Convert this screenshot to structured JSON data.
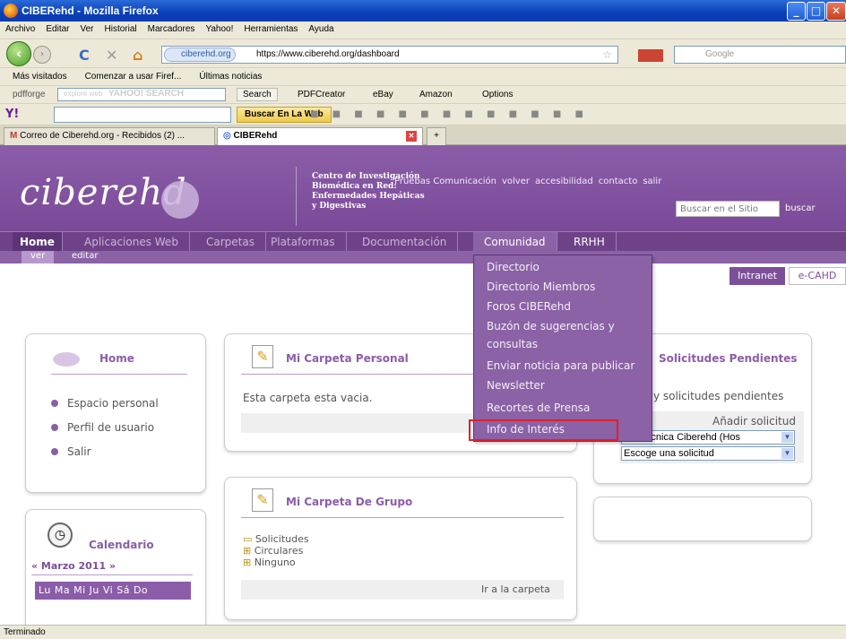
{
  "window": {
    "title": "CIBERehd - Mozilla Firefox"
  },
  "menubar": [
    "Archivo",
    "Editar",
    "Ver",
    "Historial",
    "Marcadores",
    "Yahoo!",
    "Herramientas",
    "Ayuda"
  ],
  "navbar": {
    "site_badge": "ciberehd.org",
    "url": "https://www.ciberehd.org/dashboard",
    "search_placeholder": "Google"
  },
  "bookmarks": [
    "Más visitados",
    "Comenzar a usar Firef...",
    "Últimas noticias"
  ],
  "pdfbar": {
    "brand": "pdfforge",
    "search_placeholder": "explore web",
    "yahoo": "YAHOO! SEARCH",
    "search_btn": "Search",
    "items": [
      "PDFCreator",
      "eBay",
      "Amazon",
      "Options"
    ]
  },
  "yahoobar": {
    "button": "Buscar En La Web"
  },
  "tabs": [
    {
      "label": "Correo de Ciberehd.org - Recibidos (2) ...",
      "active": false
    },
    {
      "label": "CIBERehd",
      "active": true
    }
  ],
  "header": {
    "logo": "ciberehd",
    "centro": [
      "Centro de Investigación",
      "Biomédica en Red:",
      "Enfermedades Hepáticas",
      "y Digestivas"
    ],
    "toplinks": [
      "Pruebas Comunicación",
      "volver",
      "accesibilidad",
      "contacto",
      "salir"
    ],
    "search_placeholder": "Buscar en el Sitio",
    "search_btn": "buscar"
  },
  "mainnav": [
    "Home",
    "Aplicaciones Web",
    "Carpetas",
    "Plataformas",
    "Documentación",
    "Comunidad",
    "RRHH"
  ],
  "subnav": [
    "ver",
    "editar"
  ],
  "dropdown": [
    "Directorio",
    "Directorio Miembros",
    "Foros CIBERehd",
    "Buzón de sugerencias y",
    "consultas",
    "Enviar noticia para publicar",
    "Newsletter",
    "Recortes de Prensa",
    "Info de Interés"
  ],
  "buttons": {
    "intranet": "Intranet",
    "ecahd": "e-CAHD"
  },
  "home_panel": {
    "title": "Home",
    "items": [
      "Espacio personal",
      "Perfil de usuario",
      "Salir"
    ]
  },
  "carpeta_personal": {
    "title": "Mi Carpeta Personal",
    "text": "Esta carpeta esta vacia."
  },
  "carpeta_grupo": {
    "title": "Mi Carpeta De Grupo",
    "items": [
      "Solicitudes",
      "Circulares",
      "Ninguno"
    ],
    "link": "Ir a la carpeta"
  },
  "solicitudes": {
    "title": "Solicitudes Pendientes",
    "text": "y solicitudes pendientes",
    "add": "Añadir solicitud",
    "select1": "ina Técnica Ciberehd (Hos",
    "select2": "Escoge una solicitud"
  },
  "calendario": {
    "title": "Calendario",
    "month": "« Marzo 2011 »",
    "days": "Lu Ma Mi Ju Vi Sá Do"
  },
  "status": "Terminado"
}
